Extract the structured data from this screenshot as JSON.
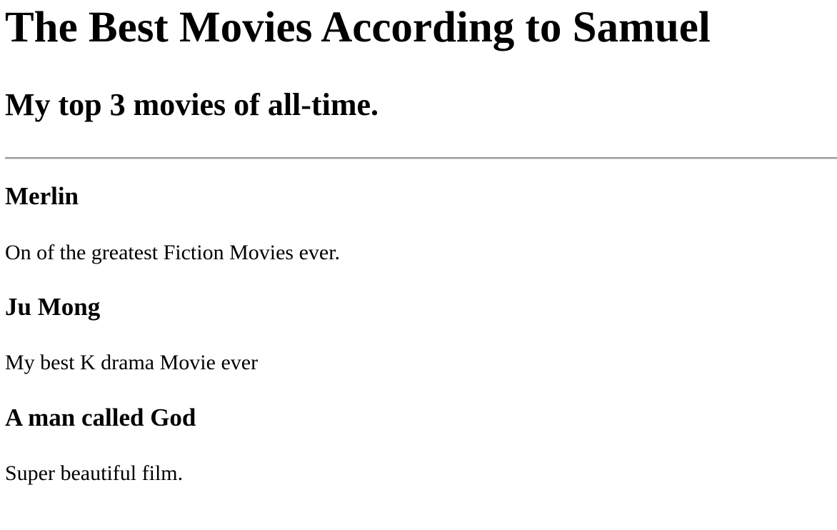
{
  "header": {
    "title": "The Best Movies According to Samuel",
    "subtitle": "My top 3 movies of all-time."
  },
  "movies": [
    {
      "title": "Merlin",
      "description": "On of the greatest Fiction Movies ever."
    },
    {
      "title": "Ju Mong",
      "description": "My best K drama Movie ever"
    },
    {
      "title": "A man called God",
      "description": "Super beautiful film."
    }
  ]
}
